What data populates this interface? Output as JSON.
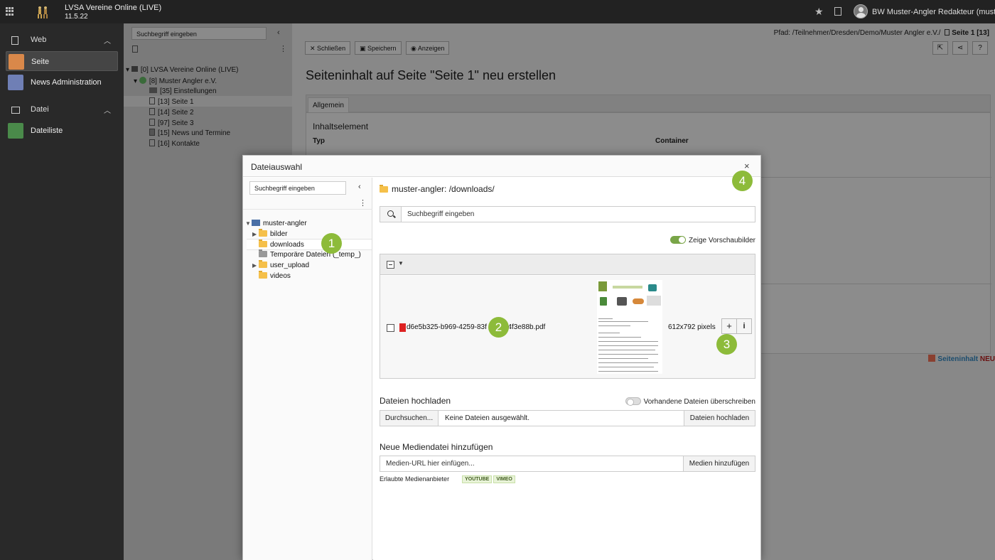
{
  "topbar": {
    "site_name": "LVSA Vereine Online (LIVE)",
    "site_version": "11.5.22",
    "username": "BW Muster-Angler Redakteur (muster-..."
  },
  "modmenu": {
    "groups": [
      {
        "label": "Web",
        "items": [
          {
            "label": "Seite",
            "color": "#d9884a"
          },
          {
            "label": "News Administration",
            "color": "#6f7fb5"
          }
        ]
      },
      {
        "label": "Datei",
        "items": [
          {
            "label": "Dateiliste",
            "color": "#4a8a4a"
          }
        ]
      }
    ]
  },
  "pagetree": {
    "search_placeholder": "Suchbegriff eingeben",
    "items": [
      {
        "label": "[0] LVSA Vereine Online (LIVE)"
      },
      {
        "label": "[8] Muster Angler e.V."
      },
      {
        "label": "[35] Einstellungen"
      },
      {
        "label": "[13] Seite 1"
      },
      {
        "label": "[14] Seite 2"
      },
      {
        "label": "[97] Seite 3"
      },
      {
        "label": "[15] News und Termine"
      },
      {
        "label": "[16] Kontakte"
      }
    ]
  },
  "main": {
    "breadcrumb_prefix": "Pfad: /Teilnehmer/Dresden/Demo/Muster Angler e.V./",
    "breadcrumb_page": "Seite 1 [13]",
    "buttons": {
      "close": "Schließen",
      "save": "Speichern",
      "view": "Anzeigen"
    },
    "title": "Seiteninhalt auf Seite \"Seite 1\" neu erstellen",
    "tab": "Allgemein",
    "section": "Inhaltselement",
    "label_type": "Typ",
    "label_container": "Container",
    "content_new": "Seiteninhalt",
    "content_new_suffix": "NEU"
  },
  "modal": {
    "title": "Dateiauswahl",
    "close": "×",
    "tree": {
      "search_placeholder": "Suchbegriff eingeben",
      "root": "muster-angler",
      "folders": [
        {
          "label": "bilder",
          "expandable": true
        },
        {
          "label": "downloads",
          "expandable": false
        },
        {
          "label": "Temporäre Dateien (_temp_)",
          "expandable": false
        },
        {
          "label": "user_upload",
          "expandable": true
        },
        {
          "label": "videos",
          "expandable": false
        }
      ]
    },
    "path": "muster-angler: /downloads/",
    "search_placeholder": "Suchbegriff eingeben",
    "show_thumbnails": "Zeige Vorschaubilder",
    "file": {
      "name": "d6e5b325-b969-4259-83f",
      "name_tail": "a4f3e88b.pdf",
      "dimensions": "612x792 pixels",
      "add": "+",
      "info": "i"
    },
    "upload": {
      "heading": "Dateien hochladen",
      "overwrite": "Vorhandene Dateien überschreiben",
      "browse": "Durchsuchen...",
      "no_file": "Keine Dateien ausgewählt.",
      "submit": "Dateien hochladen"
    },
    "media": {
      "heading": "Neue Mediendatei hinzufügen",
      "placeholder": "Medien-URL hier einfügen...",
      "submit": "Medien hinzufügen",
      "allowed_label": "Erlaubte Medienanbieter",
      "providers": [
        "YOUTUBE",
        "VIMEO"
      ]
    }
  },
  "markers": [
    "1",
    "2",
    "3",
    "4"
  ]
}
